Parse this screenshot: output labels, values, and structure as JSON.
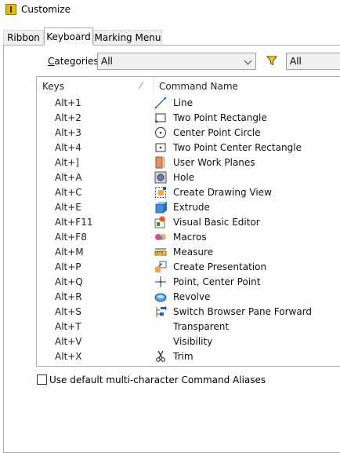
{
  "window": {
    "title": "Customize",
    "icon": "inventor-app-icon"
  },
  "tabs": [
    {
      "label": "Ribbon"
    },
    {
      "label": "Keyboard"
    },
    {
      "label": "Marking Menu"
    }
  ],
  "active_tab": "Keyboard",
  "filters": {
    "categories_label": "Categories:",
    "categories_accel": "C",
    "categories_rest": "ategories:",
    "categories_value": "All",
    "filter_icon": "funnel-icon",
    "filter_value": "All"
  },
  "table": {
    "headers": {
      "keys": "Keys",
      "command": "Command Name"
    },
    "rows": [
      {
        "key": "Alt+1",
        "command": "Line",
        "icon": "line-icon"
      },
      {
        "key": "Alt+2",
        "command": "Two Point Rectangle",
        "icon": "rectangle-icon"
      },
      {
        "key": "Alt+3",
        "command": "Center Point Circle",
        "icon": "circle-icon"
      },
      {
        "key": "Alt+4",
        "command": "Two Point Center Rectangle",
        "icon": "center-rectangle-icon"
      },
      {
        "key": "Alt+]",
        "command": "User Work Planes",
        "icon": "work-plane-icon"
      },
      {
        "key": "Alt+A",
        "command": "Hole",
        "icon": "hole-icon"
      },
      {
        "key": "Alt+C",
        "command": "Create Drawing View",
        "icon": "drawing-view-icon"
      },
      {
        "key": "Alt+E",
        "command": "Extrude",
        "icon": "extrude-icon"
      },
      {
        "key": "Alt+F11",
        "command": "Visual Basic Editor",
        "icon": "vba-editor-icon"
      },
      {
        "key": "Alt+F8",
        "command": "Macros",
        "icon": "macros-icon"
      },
      {
        "key": "Alt+M",
        "command": "Measure",
        "icon": "measure-icon"
      },
      {
        "key": "Alt+P",
        "command": "Create Presentation",
        "icon": "presentation-icon"
      },
      {
        "key": "Alt+Q",
        "command": "Point, Center Point",
        "icon": "point-icon"
      },
      {
        "key": "Alt+R",
        "command": "Revolve",
        "icon": "revolve-icon"
      },
      {
        "key": "Alt+S",
        "command": "Switch Browser Pane Forward",
        "icon": "browser-pane-icon"
      },
      {
        "key": "Alt+T",
        "command": "Transparent",
        "icon": ""
      },
      {
        "key": "Alt+V",
        "command": "Visibility",
        "icon": ""
      },
      {
        "key": "Alt+X",
        "command": "Trim",
        "icon": "trim-icon"
      }
    ]
  },
  "options": {
    "aliases_label": "Use default multi-character Command Aliases",
    "aliases_checked": false
  },
  "colors": {
    "accent": "#0078d7",
    "funnel": "#d4b000",
    "border": "#adadad"
  }
}
